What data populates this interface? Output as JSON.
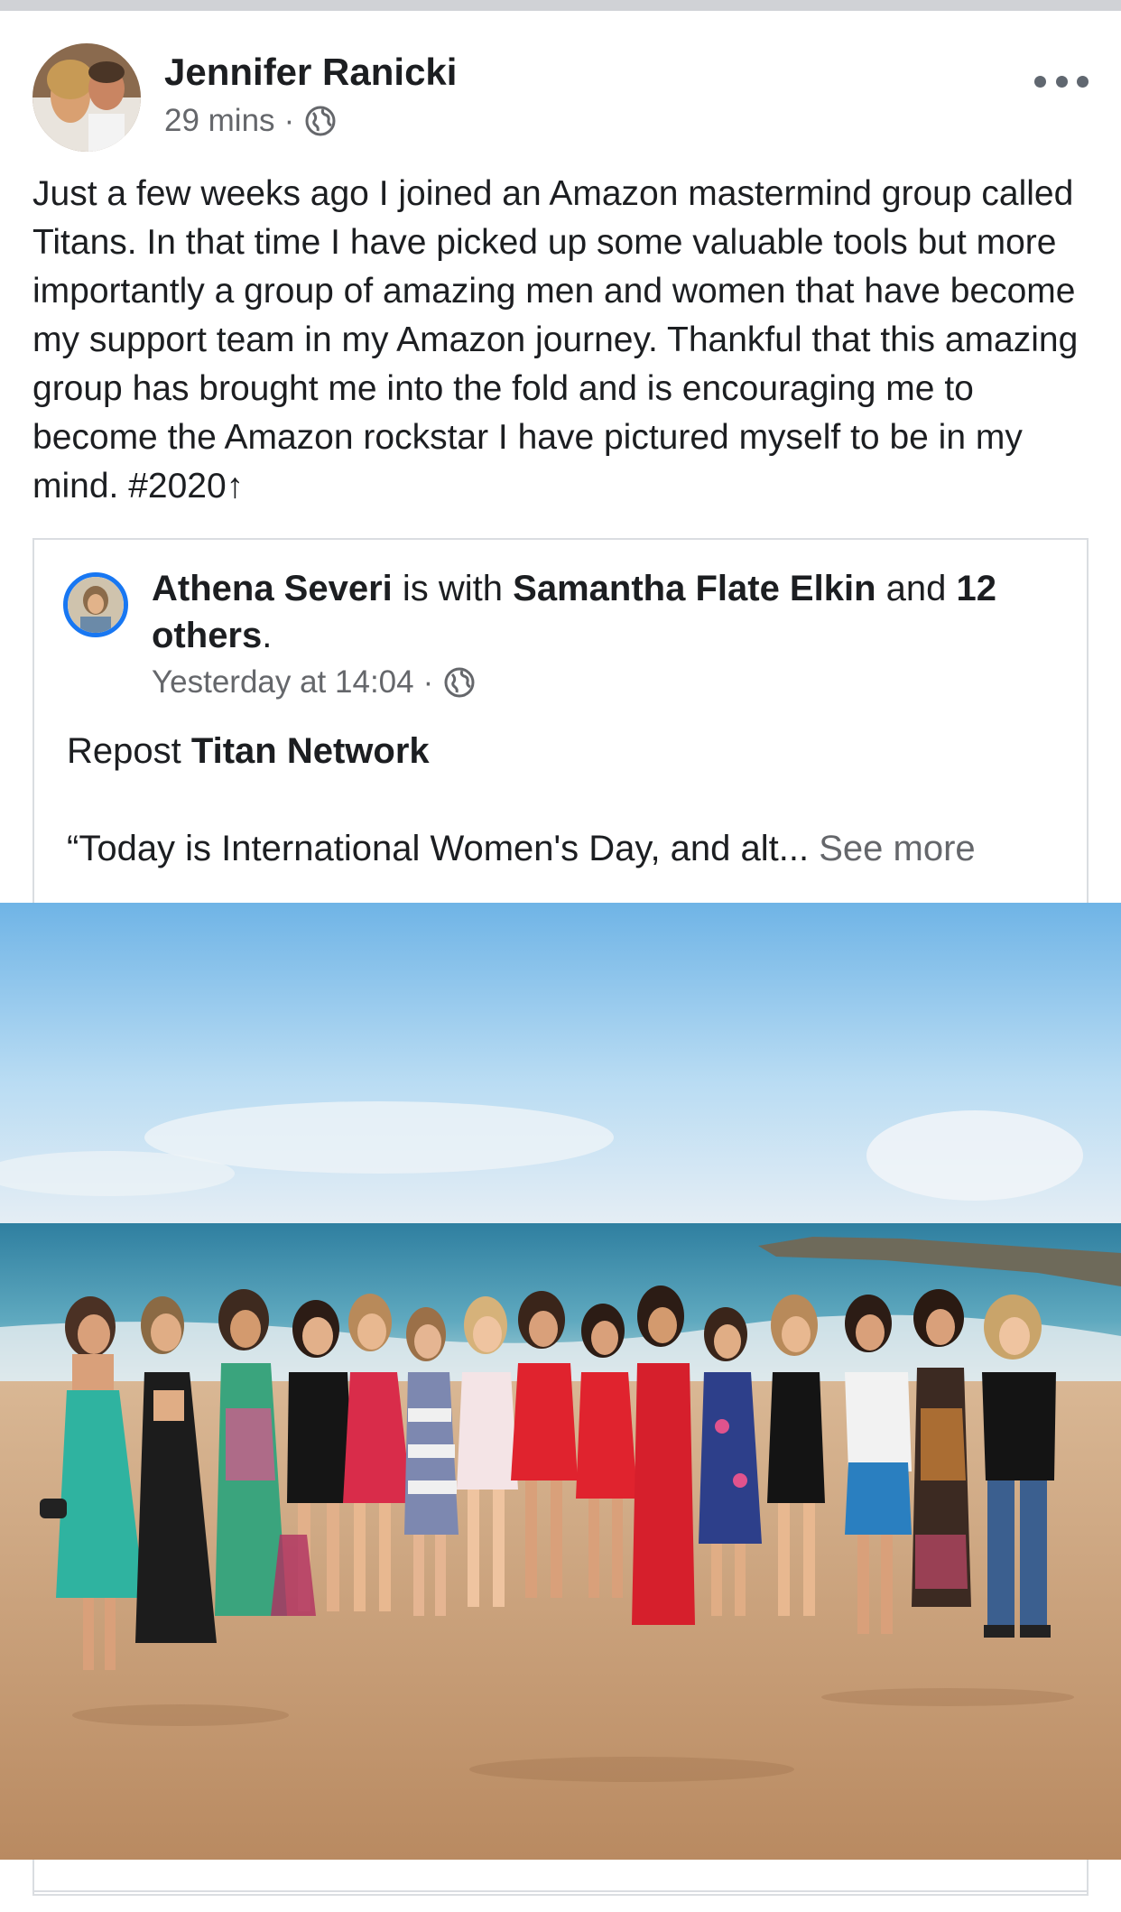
{
  "post": {
    "author": "Jennifer Ranicki",
    "time": "29 mins",
    "separator": "·",
    "privacy_icon": "globe-icon",
    "more_icon": "more-options-icon",
    "text": "Just a few weeks ago I joined an Amazon mastermind group called Titans. In that time I have picked up some valuable tools but more importantly a group of amazing men and women that have become my support team in my Amazon journey. Thankful that this amazing group has brought me into the fold and is encouraging me to become the Amazon rockstar I have pictured myself to be in my mind. #2020",
    "text_trailing_symbol": "↑"
  },
  "shared_post": {
    "author": "Athena Severi",
    "with_text": "is with",
    "tagged": "Samantha Flate Elkin",
    "and_text": "and",
    "others": "12 others",
    "period": ".",
    "time": "Yesterday at 14:04",
    "separator": "·",
    "privacy_icon": "globe-icon",
    "repost_prefix": "Repost",
    "repost_page": "Titan Network",
    "quote_text": "“Today is International Women's Day, and alt...",
    "see_more": "See more"
  },
  "colors": {
    "text": "#1c1e21",
    "secondary": "#65676b",
    "story_ring": "#1877f2",
    "border": "#dadde1"
  }
}
